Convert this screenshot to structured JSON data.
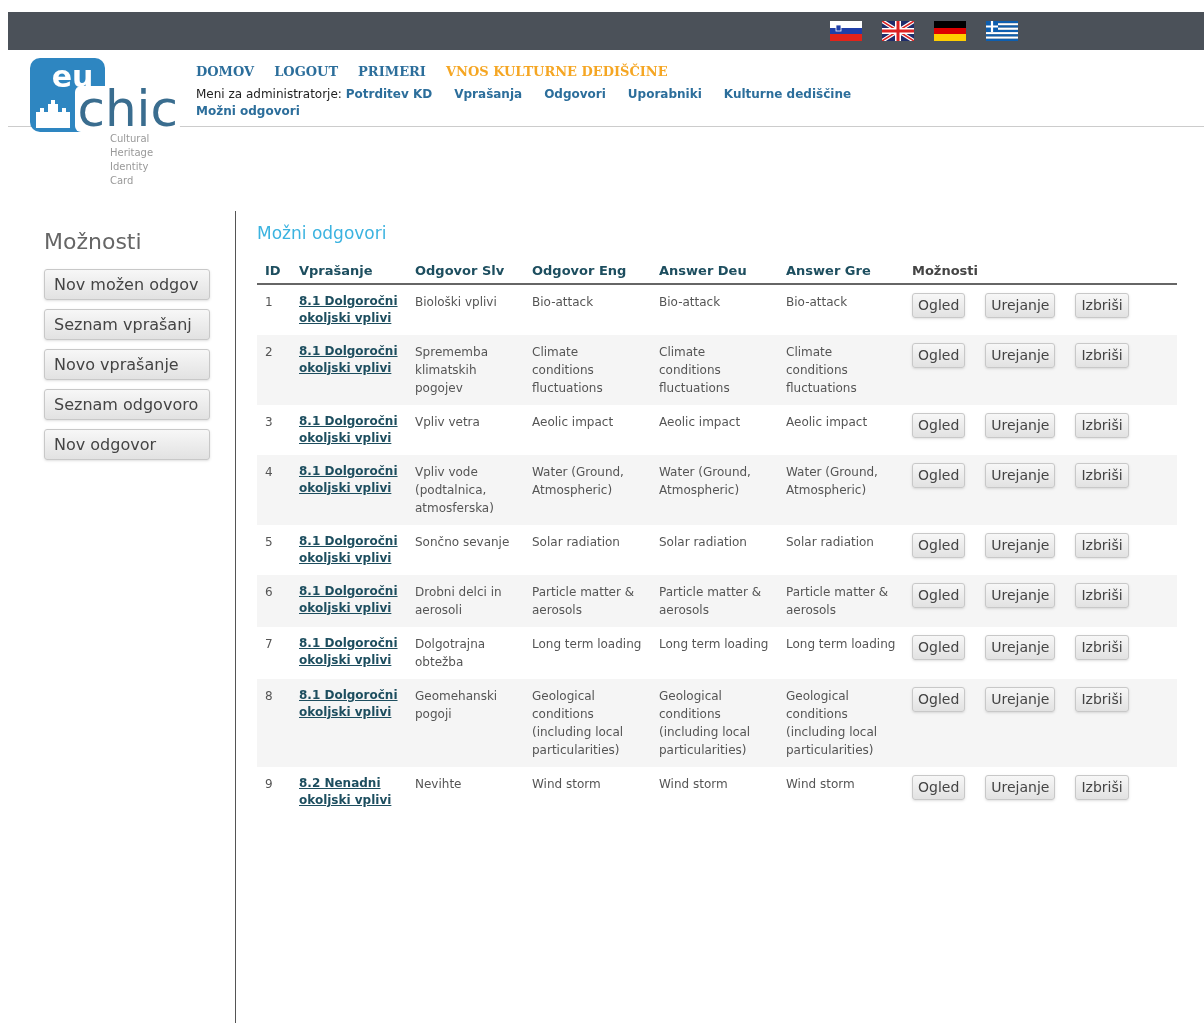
{
  "flags": [
    {
      "kind": "si"
    },
    {
      "kind": "uk"
    },
    {
      "kind": "de"
    },
    {
      "kind": "gr"
    }
  ],
  "logo": {
    "mark_top": "eu",
    "mark_bottom": "chic",
    "tagline": [
      "Cultural",
      "Heritage",
      "Identity",
      "Card"
    ]
  },
  "nav": [
    {
      "label": "DOMOV",
      "selected": false
    },
    {
      "label": "LOGOUT",
      "selected": false
    },
    {
      "label": "PRIMERI",
      "selected": false
    },
    {
      "label": "VNOS KULTURNE DEDIŠČINE",
      "selected": true
    }
  ],
  "admin_menu": {
    "label": "Meni za administratorje:",
    "links": [
      "Potrditev KD",
      "Vprašanja",
      "Odgovori",
      "Uporabniki",
      "Kulturne dediščine",
      "Možni odgovori"
    ]
  },
  "sidebar": {
    "title": "Možnosti",
    "buttons": [
      "Nov možen odgov",
      "Seznam vprašanj",
      "Novo vprašanje",
      "Seznam odgovoro",
      "Nov odgovor"
    ]
  },
  "content": {
    "title": "Možni odgovori"
  },
  "table": {
    "columns": [
      "ID",
      "Vprašanje",
      "Odgovor Slv",
      "Odgovor Eng",
      "Answer Deu",
      "Answer Gre",
      "Možnosti"
    ],
    "rows": [
      {
        "id": "1",
        "question": "8.1 Dolgoročni okoljski vplivi",
        "slv": "Biološki vplivi",
        "eng": "Bio-attack",
        "deu": "Bio-attack",
        "gre": "Bio-attack",
        "actions": [
          "Ogled",
          "Urejanje",
          "Izbriši"
        ]
      },
      {
        "id": "2",
        "question": "8.1 Dolgoročni okoljski vplivi",
        "slv": "Sprememba klimatskih pogojev",
        "eng": "Climate conditions fluctuations",
        "deu": "Climate conditions fluctuations",
        "gre": "Climate conditions fluctuations",
        "actions": [
          "Ogled",
          "Urejanje",
          "Izbriši"
        ]
      },
      {
        "id": "3",
        "question": "8.1 Dolgoročni okoljski vplivi",
        "slv": "Vpliv vetra",
        "eng": "Aeolic impact",
        "deu": "Aeolic impact",
        "gre": "Aeolic impact",
        "actions": [
          "Ogled",
          "Urejanje",
          "Izbriši"
        ]
      },
      {
        "id": "4",
        "question": "8.1 Dolgoročni okoljski vplivi",
        "slv": "Vpliv vode (podtalnica, atmosferska)",
        "eng": "Water (Ground, Atmospheric)",
        "deu": "Water (Ground, Atmospheric)",
        "gre": "Water (Ground, Atmospheric)",
        "actions": [
          "Ogled",
          "Urejanje",
          "Izbriši"
        ]
      },
      {
        "id": "5",
        "question": "8.1 Dolgoročni okoljski vplivi",
        "slv": "Sončno sevanje",
        "eng": "Solar radiation",
        "deu": "Solar radiation",
        "gre": "Solar radiation",
        "actions": [
          "Ogled",
          "Urejanje",
          "Izbriši"
        ]
      },
      {
        "id": "6",
        "question": "8.1 Dolgoročni okoljski vplivi",
        "slv": "Drobni delci in aerosoli",
        "eng": "Particle matter & aerosols",
        "deu": "Particle matter & aerosols",
        "gre": "Particle matter & aerosols",
        "actions": [
          "Ogled",
          "Urejanje",
          "Izbriši"
        ]
      },
      {
        "id": "7",
        "question": "8.1 Dolgoročni okoljski vplivi",
        "slv": "Dolgotrajna obtežba",
        "eng": "Long term loading",
        "deu": "Long term loading",
        "gre": "Long term loading",
        "actions": [
          "Ogled",
          "Urejanje",
          "Izbriši"
        ]
      },
      {
        "id": "8",
        "question": "8.1 Dolgoročni okoljski vplivi",
        "slv": "Geomehanski pogoji",
        "eng": "Geological conditions (including local particularities)",
        "deu": "Geological conditions (including local particularities)",
        "gre": "Geological conditions (including local particularities)",
        "actions": [
          "Ogled",
          "Urejanje",
          "Izbriši"
        ]
      },
      {
        "id": "9",
        "question": "8.2 Nenadni okoljski vplivi",
        "slv": "Nevihte",
        "eng": "Wind storm",
        "deu": "Wind storm",
        "gre": "Wind storm",
        "actions": [
          "Ogled",
          "Urejanje",
          "Izbriši"
        ]
      }
    ]
  }
}
